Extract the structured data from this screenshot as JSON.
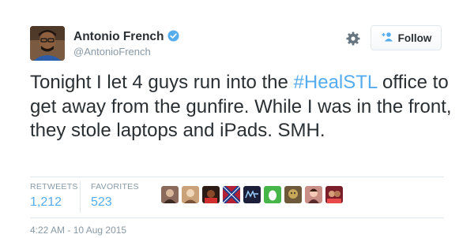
{
  "author": {
    "name": "Antonio French",
    "handle": "@AntonioFrench",
    "verified": true
  },
  "follow_button": {
    "label": "Follow"
  },
  "tweet": {
    "text_before": "Tonight I let 4 guys run into the ",
    "hashtag": "#HealSTL",
    "text_after": " office to get away from the gunfire. While I was in the front, they stole laptops and iPads. SMH."
  },
  "stats": {
    "retweets_label": "RETWEETS",
    "retweets_value": "1,212",
    "favorites_label": "FAVORITES",
    "favorites_value": "523"
  },
  "favoriter_avatars": [
    {
      "icon": "avatar-thumb-icon",
      "color": "#8a6a5a"
    },
    {
      "icon": "avatar-thumb-icon",
      "color": "#c9a27a"
    },
    {
      "icon": "avatar-thumb-icon",
      "color": "#2b1b14"
    },
    {
      "icon": "flag-avatar-icon",
      "color": "#b22234"
    },
    {
      "icon": "text-avatar-icon",
      "color": "#1b1f3a"
    },
    {
      "icon": "egg-avatar-icon",
      "color": "#47b648"
    },
    {
      "icon": "avatar-thumb-icon",
      "color": "#6e5a3a"
    },
    {
      "icon": "avatar-thumb-icon",
      "color": "#c98e86"
    },
    {
      "icon": "avatar-thumb-icon",
      "color": "#7a1e2a"
    }
  ],
  "timestamp": "4:22 AM - 10 Aug 2015",
  "colors": {
    "link": "#55acee",
    "text": "#292f33",
    "muted": "#8899a6",
    "verified": "#55acee"
  }
}
